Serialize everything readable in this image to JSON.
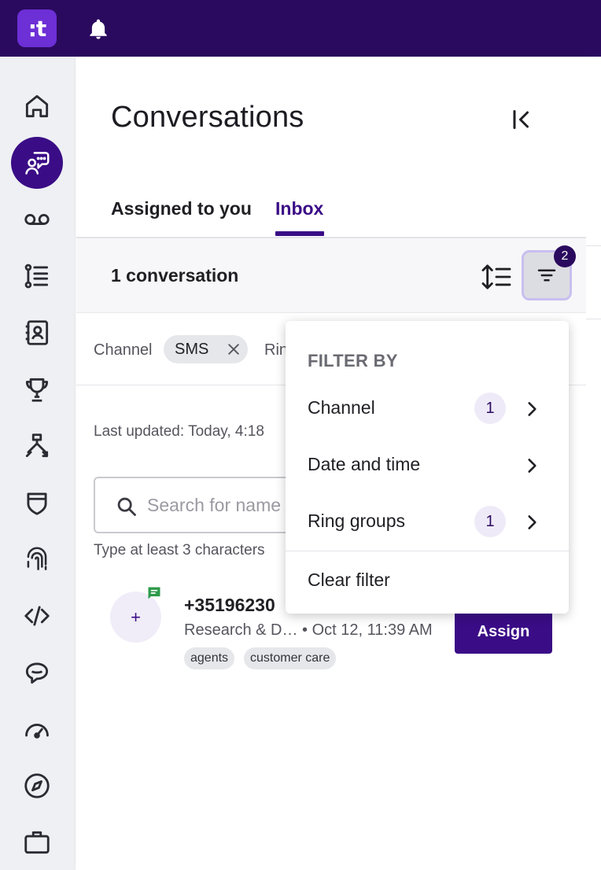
{
  "app": {
    "logo_text": ":t"
  },
  "topbar": {
    "bell_icon": "bell-icon"
  },
  "sidebar": {
    "items": [
      {
        "name": "home",
        "icon": "home-icon"
      },
      {
        "name": "conversations",
        "icon": "conversation-icon",
        "active": true
      },
      {
        "name": "voicemail",
        "icon": "voicemail-icon"
      },
      {
        "name": "lists",
        "icon": "list-icon"
      },
      {
        "name": "contacts",
        "icon": "contacts-icon"
      },
      {
        "name": "trophy",
        "icon": "trophy-icon"
      },
      {
        "name": "routing",
        "icon": "routing-icon"
      },
      {
        "name": "security",
        "icon": "shield-icon"
      },
      {
        "name": "fingerprint",
        "icon": "fingerprint-icon"
      },
      {
        "name": "developer",
        "icon": "code-icon"
      },
      {
        "name": "chat-bot",
        "icon": "chat-bubble-icon"
      },
      {
        "name": "performance",
        "icon": "gauge-icon"
      },
      {
        "name": "explore",
        "icon": "compass-icon"
      },
      {
        "name": "work",
        "icon": "briefcase-icon"
      }
    ]
  },
  "panel": {
    "title": "Conversations",
    "tabs": [
      {
        "label": "Assigned to you",
        "active": false
      },
      {
        "label": "Inbox",
        "active": true
      }
    ],
    "count_text": "1 conversation",
    "filter_badge": "2",
    "chips": {
      "channel_label": "Channel",
      "sms_chip": "SMS",
      "ring_label_partial": "Rin"
    },
    "last_updated": "Last updated: Today, 4:18",
    "search": {
      "placeholder": "Search for name",
      "hint": "Type at least 3 characters"
    },
    "conversation": {
      "avatar_symbol": "+",
      "phone": "+35196230",
      "meta": "Research & D… • Oct 12, 11:39 AM",
      "tags": [
        "agents",
        "customer care"
      ],
      "assign_label": "Assign"
    }
  },
  "filter_menu": {
    "heading": "FILTER BY",
    "items": [
      {
        "label": "Channel",
        "count": "1"
      },
      {
        "label": "Date and time",
        "count": null
      },
      {
        "label": "Ring groups",
        "count": "1"
      }
    ],
    "clear_label": "Clear filter"
  },
  "colors": {
    "brand_dark": "#2a0a5e",
    "brand": "#3a0c86",
    "accent_logo": "#6d2fd6",
    "sms_green": "#2e9a4a"
  }
}
